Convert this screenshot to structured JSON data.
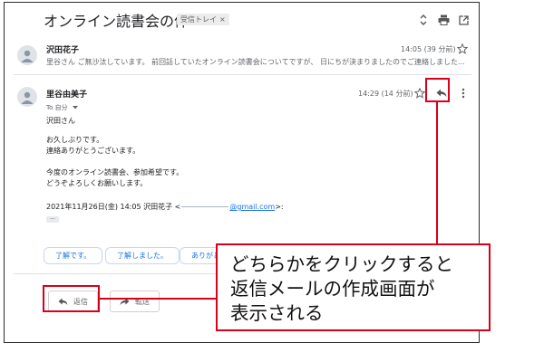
{
  "thread": {
    "subject": "オンライン読書会の件",
    "label_chip": "受信トレイ",
    "label_chip_close": "×"
  },
  "message1": {
    "sender": "沢田花子",
    "time": "14:05 (39 分前)",
    "snippet": "里谷さん ご無沙汰しています。 前回話していたオンライン読書会についてですが、 日にちが決まりましたのでご連絡しました..."
  },
  "message2": {
    "sender": "里谷由美子",
    "time": "14:29 (14 分前)",
    "to": "To 自分",
    "body": [
      "沢田さん",
      "お久しぶりです。",
      "連絡ありがとうございます。",
      "今度のオンライン読書会、参加希望です。",
      "どうぞよろしくお願いします。"
    ],
    "quote_prefix": "2021年11月26日(金) 14:05 沢田花子 <",
    "quote_email": "@gmail.com",
    "quote_suffix": ">:",
    "ellipsis": "..."
  },
  "smart_replies": [
    "了解です。",
    "了解しました。",
    "ありがと"
  ],
  "actions": {
    "reply": "返信",
    "forward": "転送"
  },
  "callout": {
    "lines": [
      "どちらかをクリックすると",
      "返信メールの作成画面が",
      "表示される"
    ]
  },
  "colors": {
    "highlight": "#d9001b",
    "link": "#1a73e8"
  }
}
